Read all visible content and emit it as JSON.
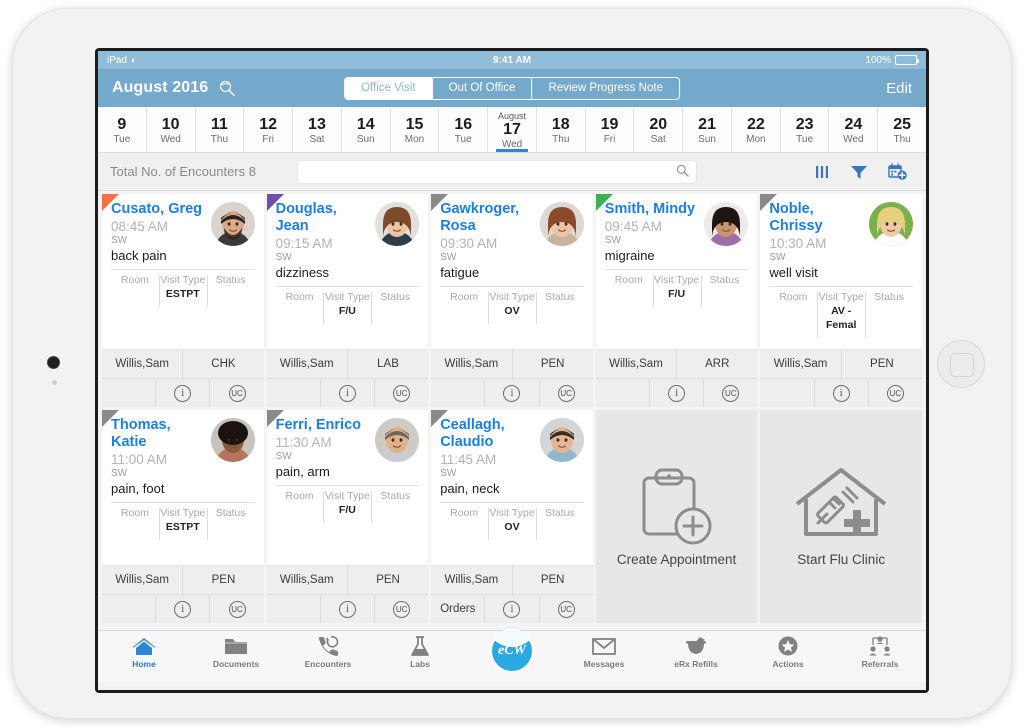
{
  "status_bar": {
    "device": "iPad",
    "wifi_icon": "wifi-icon",
    "time": "9:41 AM",
    "battery_pct": "100%"
  },
  "header": {
    "month_title": "August 2016",
    "search_icon": "month-search-icon",
    "edit_label": "Edit",
    "segments": [
      {
        "label": "Office Visit",
        "active": true
      },
      {
        "label": "Out Of Office",
        "active": false
      },
      {
        "label": "Review Progress Note",
        "active": false
      }
    ]
  },
  "date_strip": [
    {
      "month": "",
      "num": "9",
      "dow": "Tue",
      "selected": false,
      "partial": true
    },
    {
      "month": "",
      "num": "10",
      "dow": "Wed",
      "selected": false,
      "partial": false
    },
    {
      "month": "",
      "num": "11",
      "dow": "Thu",
      "selected": false,
      "partial": false
    },
    {
      "month": "",
      "num": "12",
      "dow": "Fri",
      "selected": false,
      "partial": false
    },
    {
      "month": "",
      "num": "13",
      "dow": "Sat",
      "selected": false,
      "partial": false
    },
    {
      "month": "",
      "num": "14",
      "dow": "Sun",
      "selected": false,
      "partial": false
    },
    {
      "month": "",
      "num": "15",
      "dow": "Mon",
      "selected": false,
      "partial": false
    },
    {
      "month": "",
      "num": "16",
      "dow": "Tue",
      "selected": false,
      "partial": false
    },
    {
      "month": "August",
      "num": "17",
      "dow": "Wed",
      "selected": true,
      "partial": false
    },
    {
      "month": "",
      "num": "18",
      "dow": "Thu",
      "selected": false,
      "partial": false
    },
    {
      "month": "",
      "num": "19",
      "dow": "Fri",
      "selected": false,
      "partial": false
    },
    {
      "month": "",
      "num": "20",
      "dow": "Sat",
      "selected": false,
      "partial": false
    },
    {
      "month": "",
      "num": "21",
      "dow": "Sun",
      "selected": false,
      "partial": false
    },
    {
      "month": "",
      "num": "22",
      "dow": "Mon",
      "selected": false,
      "partial": false
    },
    {
      "month": "",
      "num": "23",
      "dow": "Tue",
      "selected": false,
      "partial": false
    },
    {
      "month": "",
      "num": "24",
      "dow": "Wed",
      "selected": false,
      "partial": false
    },
    {
      "month": "",
      "num": "25",
      "dow": "Thu",
      "selected": false,
      "partial": true
    }
  ],
  "toolbar": {
    "encounter_count_label": "Total No. of Encounters 8",
    "search_value": "",
    "search_placeholder": "",
    "search_icon": "search-icon",
    "icons": [
      {
        "name": "columns-view-icon"
      },
      {
        "name": "filter-funnel-icon"
      },
      {
        "name": "calendar-add-icon"
      }
    ]
  },
  "cards": [
    {
      "flag_color": "#f0714a",
      "name": "Cusato, Greg",
      "time": "08:45 AM",
      "provider": "SW",
      "reason": "back pain",
      "meta": [
        {
          "label": "Room",
          "value": ""
        },
        {
          "label": "Visit Type",
          "value": "ESTPT"
        },
        {
          "label": "Status",
          "value": ""
        }
      ],
      "foot_left": "Willis,Sam",
      "foot_right": "CHK",
      "foot2_left": "",
      "info_icon": "i",
      "uc_icon": "UC",
      "avatar": "avatar-male-beard"
    },
    {
      "flag_color": "#6f4fa8",
      "name": "Douglas, Jean",
      "time": "09:15 AM",
      "provider": "SW",
      "reason": "dizziness",
      "meta": [
        {
          "label": "Room",
          "value": ""
        },
        {
          "label": "Visit Type",
          "value": "F/U"
        },
        {
          "label": "Status",
          "value": ""
        }
      ],
      "foot_left": "Willis,Sam",
      "foot_right": "LAB",
      "foot2_left": "",
      "info_icon": "i",
      "uc_icon": "UC",
      "avatar": "avatar-female-brown"
    },
    {
      "flag_color": "#8a8a8a",
      "name": "Gawkroger, Rosa",
      "time": "09:30 AM",
      "provider": "SW",
      "reason": "fatigue",
      "meta": [
        {
          "label": "Room",
          "value": ""
        },
        {
          "label": "Visit Type",
          "value": "OV"
        },
        {
          "label": "Status",
          "value": ""
        }
      ],
      "foot_left": "Willis,Sam",
      "foot_right": "PEN",
      "foot2_left": "",
      "info_icon": "i",
      "uc_icon": "UC",
      "avatar": "avatar-female-auburn"
    },
    {
      "flag_color": "#3fae52",
      "name": "Smith, Mindy",
      "time": "09:45 AM",
      "provider": "SW",
      "reason": "migraine",
      "meta": [
        {
          "label": "Room",
          "value": ""
        },
        {
          "label": "Visit Type",
          "value": "F/U"
        },
        {
          "label": "Status",
          "value": ""
        }
      ],
      "foot_left": "Willis,Sam",
      "foot_right": "ARR",
      "foot2_left": "",
      "info_icon": "i",
      "uc_icon": "UC",
      "avatar": "avatar-female-dark"
    },
    {
      "flag_color": "#8a8a8a",
      "name": "Noble, Chrissy",
      "time": "10:30 AM",
      "provider": "SW",
      "reason": "well visit",
      "meta": [
        {
          "label": "Room",
          "value": ""
        },
        {
          "label": "Visit Type",
          "value": "AV - Femal"
        },
        {
          "label": "Status",
          "value": ""
        }
      ],
      "foot_left": "Willis,Sam",
      "foot_right": "PEN",
      "foot2_left": "",
      "info_icon": "i",
      "uc_icon": "UC",
      "avatar": "avatar-female-blonde"
    },
    {
      "flag_color": "#8a8a8a",
      "name": "Thomas, Katie",
      "time": "11:00 AM",
      "provider": "SW",
      "reason": "pain, foot",
      "meta": [
        {
          "label": "Room",
          "value": ""
        },
        {
          "label": "Visit Type",
          "value": "ESTPT"
        },
        {
          "label": "Status",
          "value": ""
        }
      ],
      "foot_left": "Willis,Sam",
      "foot_right": "PEN",
      "foot2_left": "",
      "info_icon": "i",
      "uc_icon": "UC",
      "avatar": "avatar-female-black"
    },
    {
      "flag_color": "#8a8a8a",
      "name": "Ferri, Enrico",
      "time": "11:30 AM",
      "provider": "SW",
      "reason": "pain, arm",
      "meta": [
        {
          "label": "Room",
          "value": ""
        },
        {
          "label": "Visit Type",
          "value": "F/U"
        },
        {
          "label": "Status",
          "value": ""
        }
      ],
      "foot_left": "Willis,Sam",
      "foot_right": "PEN",
      "foot2_left": "",
      "info_icon": "i",
      "uc_icon": "UC",
      "avatar": "avatar-male-gray"
    },
    {
      "flag_color": "#8a8a8a",
      "name": "Ceallagh, Claudio",
      "time": "11:45 AM",
      "provider": "SW",
      "reason": "pain, neck",
      "meta": [
        {
          "label": "Room",
          "value": ""
        },
        {
          "label": "Visit Type",
          "value": "OV"
        },
        {
          "label": "Status",
          "value": ""
        }
      ],
      "foot_left": "Willis,Sam",
      "foot_right": "PEN",
      "foot2_left": "Orders",
      "info_icon": "i",
      "uc_icon": "UC",
      "avatar": "avatar-male-young"
    }
  ],
  "action_tiles": [
    {
      "label": "Create Appointment",
      "icon": "clipboard-plus-icon"
    },
    {
      "label": "Start Flu Clinic",
      "icon": "house-syringe-icon"
    }
  ],
  "tabbar": [
    {
      "label": "Home",
      "icon": "home-icon",
      "active": true
    },
    {
      "label": "Documents",
      "icon": "folder-icon",
      "active": false
    },
    {
      "label": "Encounters",
      "icon": "phone-refresh-icon",
      "active": false
    },
    {
      "label": "Labs",
      "icon": "flask-icon",
      "active": false
    },
    {
      "label": "eCW",
      "icon": "ecw-logo-icon",
      "active": false,
      "is_logo": true
    },
    {
      "label": "Messages",
      "icon": "envelope-icon",
      "active": false
    },
    {
      "label": "eRx Refills",
      "icon": "mortar-pestle-icon",
      "active": false
    },
    {
      "label": "Actions",
      "icon": "star-circle-icon",
      "active": false
    },
    {
      "label": "Referrals",
      "icon": "referral-people-icon",
      "active": false
    }
  ],
  "colors": {
    "header_blue": "#74a9cc",
    "status_blue": "#8fbcd9",
    "accent_blue": "#2f86d4",
    "name_blue": "#1a7fe0",
    "icon_blue": "#3a76bd"
  }
}
